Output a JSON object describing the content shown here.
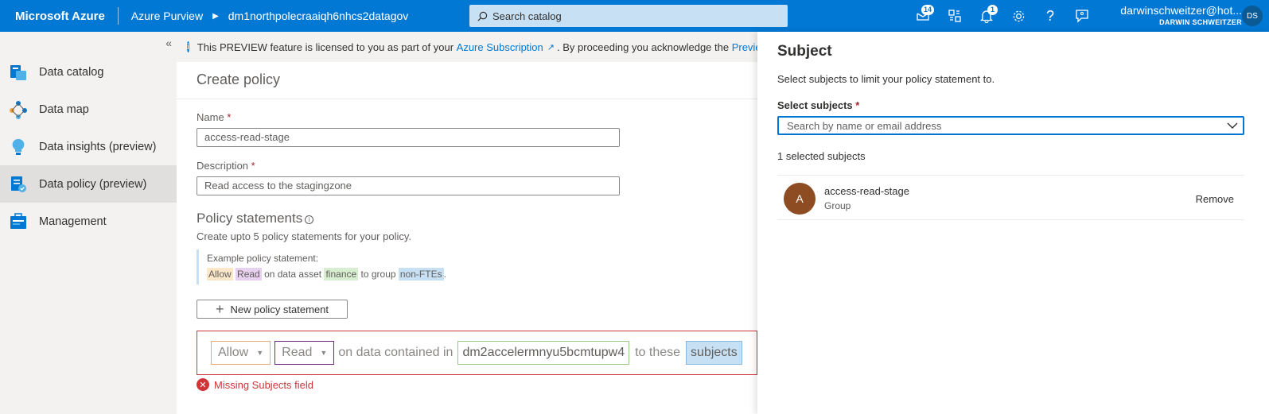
{
  "topbar": {
    "brand": "Microsoft Azure",
    "app_name": "Azure Purview",
    "account": "dm1northpolecraaiqh6nhcs2datagov",
    "search_placeholder": "Search catalog",
    "feedback_badge": "14",
    "notifications_badge": "1",
    "user_email": "darwinschweitzer@hot...",
    "user_name": "DARWIN SCHWEITZER",
    "user_initials": "DS"
  },
  "sidebar": {
    "items": [
      {
        "label": "Data catalog",
        "icon": "data-catalog-icon"
      },
      {
        "label": "Data map",
        "icon": "data-map-icon"
      },
      {
        "label": "Data insights (preview)",
        "icon": "data-insights-icon"
      },
      {
        "label": "Data policy (preview)",
        "icon": "data-policy-icon",
        "active": true
      },
      {
        "label": "Management",
        "icon": "management-icon"
      }
    ]
  },
  "info_bar": {
    "text_before": "This PREVIEW feature is licensed to you as part of your ",
    "link": "Azure Subscription",
    "text_after": ". By proceeding you acknowledge the ",
    "link2": "Previe"
  },
  "form": {
    "page_title": "Create policy",
    "name_label": "Name",
    "name_value": "access-read-stage",
    "description_label": "Description",
    "description_value": "Read access to the stagingzone",
    "required_mark": "*",
    "section_title": "Policy statements",
    "section_desc": "Create upto 5 policy statements for your policy.",
    "example_title": "Example policy statement:",
    "example": {
      "allow": "Allow",
      "read": "Read",
      "on_data_asset": "on data asset",
      "finance": "finance",
      "to_group": "to group",
      "group": "non-FTEs",
      "period": "."
    },
    "new_statement_label": "New policy statement",
    "statement": {
      "effect": "Allow",
      "action": "Read",
      "on_data": "on data contained in",
      "asset": "dm2accelermnyu5bcmtupw4",
      "to_these": "to these",
      "subjects": "subjects"
    },
    "error": "Missing Subjects field"
  },
  "panel": {
    "title": "Subject",
    "description": "Select subjects to limit your policy statement to.",
    "select_label": "Select subjects",
    "required_mark": "*",
    "search_placeholder": "Search by name or email address",
    "selected_count": "1 selected subjects",
    "subjects": [
      {
        "initial": "A",
        "name": "access-read-stage",
        "type": "Group",
        "remove_label": "Remove"
      }
    ]
  },
  "colors": {
    "brand_blue": "#0078d4",
    "error_red": "#d13438",
    "avatar_brown": "#8e4c22"
  }
}
